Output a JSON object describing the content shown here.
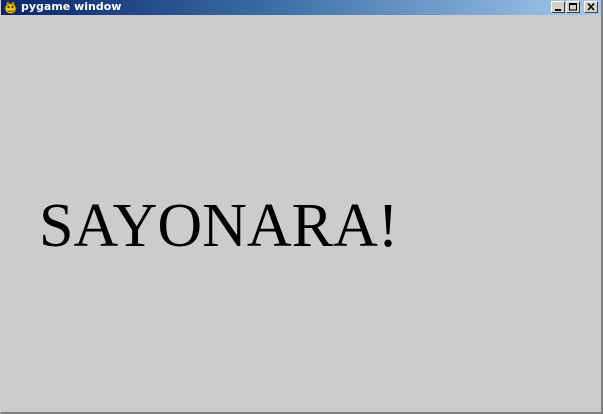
{
  "window": {
    "title": "pygame window",
    "app_icon": "pygame-snake-icon",
    "controls": {
      "minimize_icon": "minimize-icon",
      "maximize_icon": "maximize-icon",
      "close_icon": "close-icon"
    }
  },
  "content": {
    "message": "SAYONARA!"
  },
  "colors": {
    "background": "#cccccc",
    "text": "#000000",
    "titlebar_start": "#0a246a",
    "titlebar_end": "#a6caf0"
  }
}
